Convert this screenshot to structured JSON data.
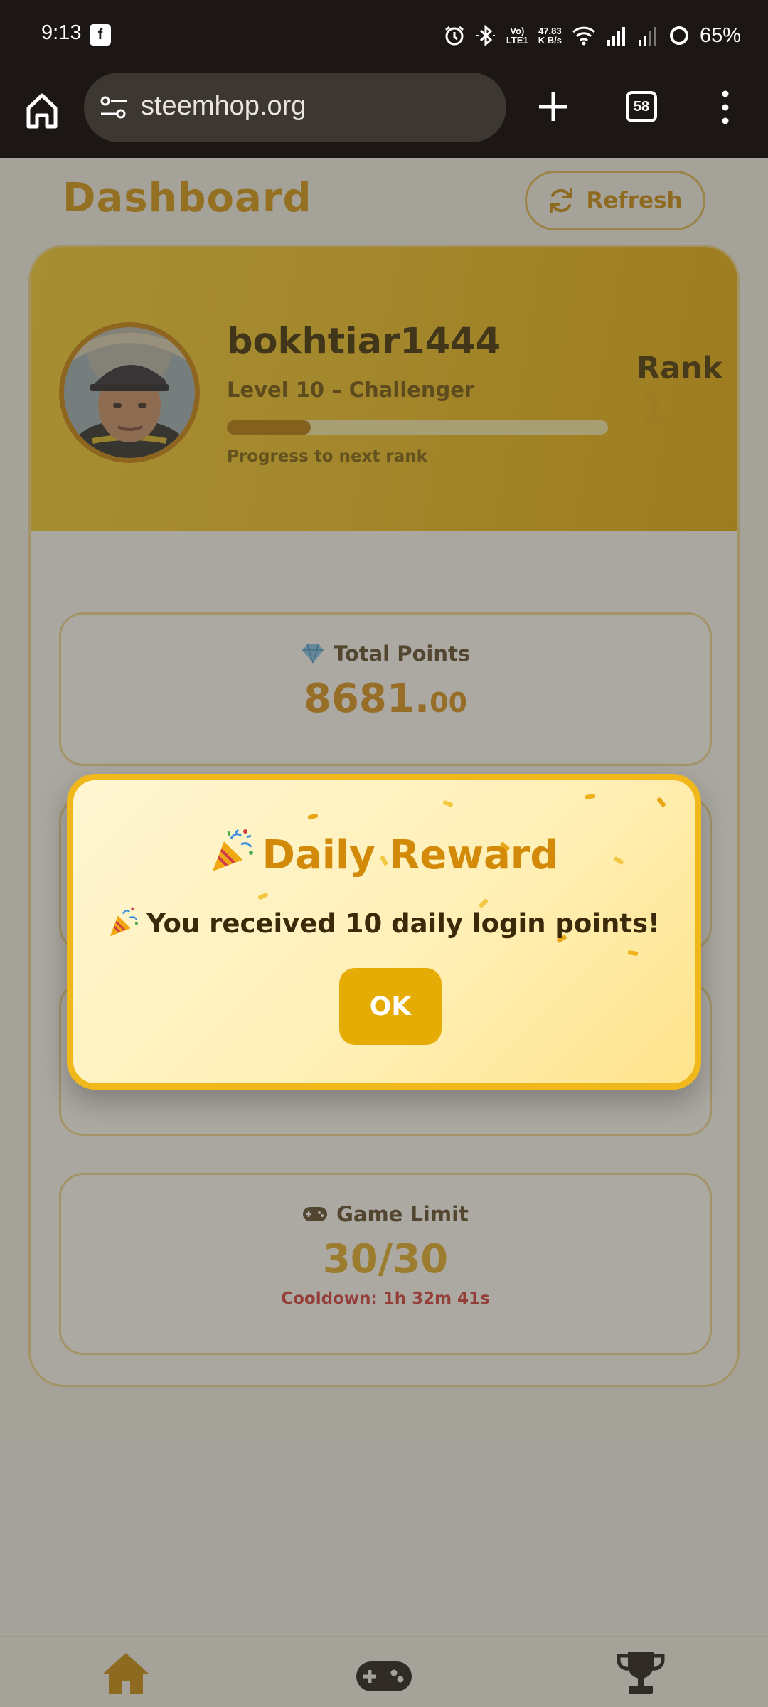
{
  "status_bar": {
    "time": "9:13",
    "volte_line1": "Vo)",
    "volte_line2": "LTE1",
    "net_speed_value": "47.83",
    "net_speed_unit": "K B/s",
    "battery": "65%"
  },
  "browser": {
    "url": "steemhop.org",
    "tab_count": "58"
  },
  "header": {
    "title": "Dashboard",
    "refresh_label": "Refresh"
  },
  "profile": {
    "username": "bokhtiar1444",
    "level": "Level 10 – Challenger",
    "progress_label": "Progress to next rank",
    "progress_fraction": 0.22,
    "rank_label": "Rank",
    "rank_value": "1"
  },
  "stats": {
    "total_points_title": "Total Points",
    "total_points_whole": "8681.",
    "total_points_decimal": "00",
    "game_limit_title": "Game Limit",
    "game_limit_value": "30/30",
    "cooldown": "Cooldown: 1h 32m 41s"
  },
  "modal": {
    "title": "Daily Reward",
    "message": "You received 10 daily login points!",
    "ok_label": "OK"
  },
  "icons": {
    "home": "home-icon",
    "game": "gamepad-icon",
    "trophy": "trophy-icon",
    "diamond": "diamond-icon",
    "party": "party-popper-icon"
  },
  "colors": {
    "accent": "#e6ac06",
    "title_gold": "#d49613",
    "cooldown_red": "#d43b3b"
  }
}
